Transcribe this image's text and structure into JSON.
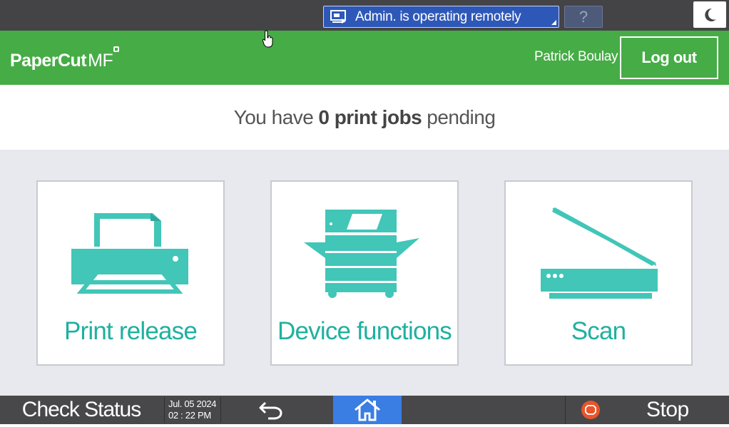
{
  "system_bar": {
    "remote_status": "Admin. is operating remotely",
    "help_label": "?"
  },
  "header": {
    "brand": "PaperCut",
    "brand_suffix": "MF",
    "user_name": "Patrick Boulay",
    "logout_label": "Log out",
    "accent_color": "#46ac46"
  },
  "pending": {
    "prefix": "You have",
    "count_text": "0 print jobs",
    "suffix": "pending"
  },
  "tiles": [
    {
      "label": "Print release",
      "icon": "printer-icon"
    },
    {
      "label": "Device functions",
      "icon": "copier-icon"
    },
    {
      "label": "Scan",
      "icon": "scanner-icon"
    }
  ],
  "tile_color": "#41c6b8",
  "bottom_bar": {
    "check_status_label": "Check Status",
    "date": "Jul. 05 2024",
    "time": "02 : 22 PM",
    "stop_label": "Stop",
    "home_color": "#3a7de3",
    "stop_color": "#e8552b"
  }
}
